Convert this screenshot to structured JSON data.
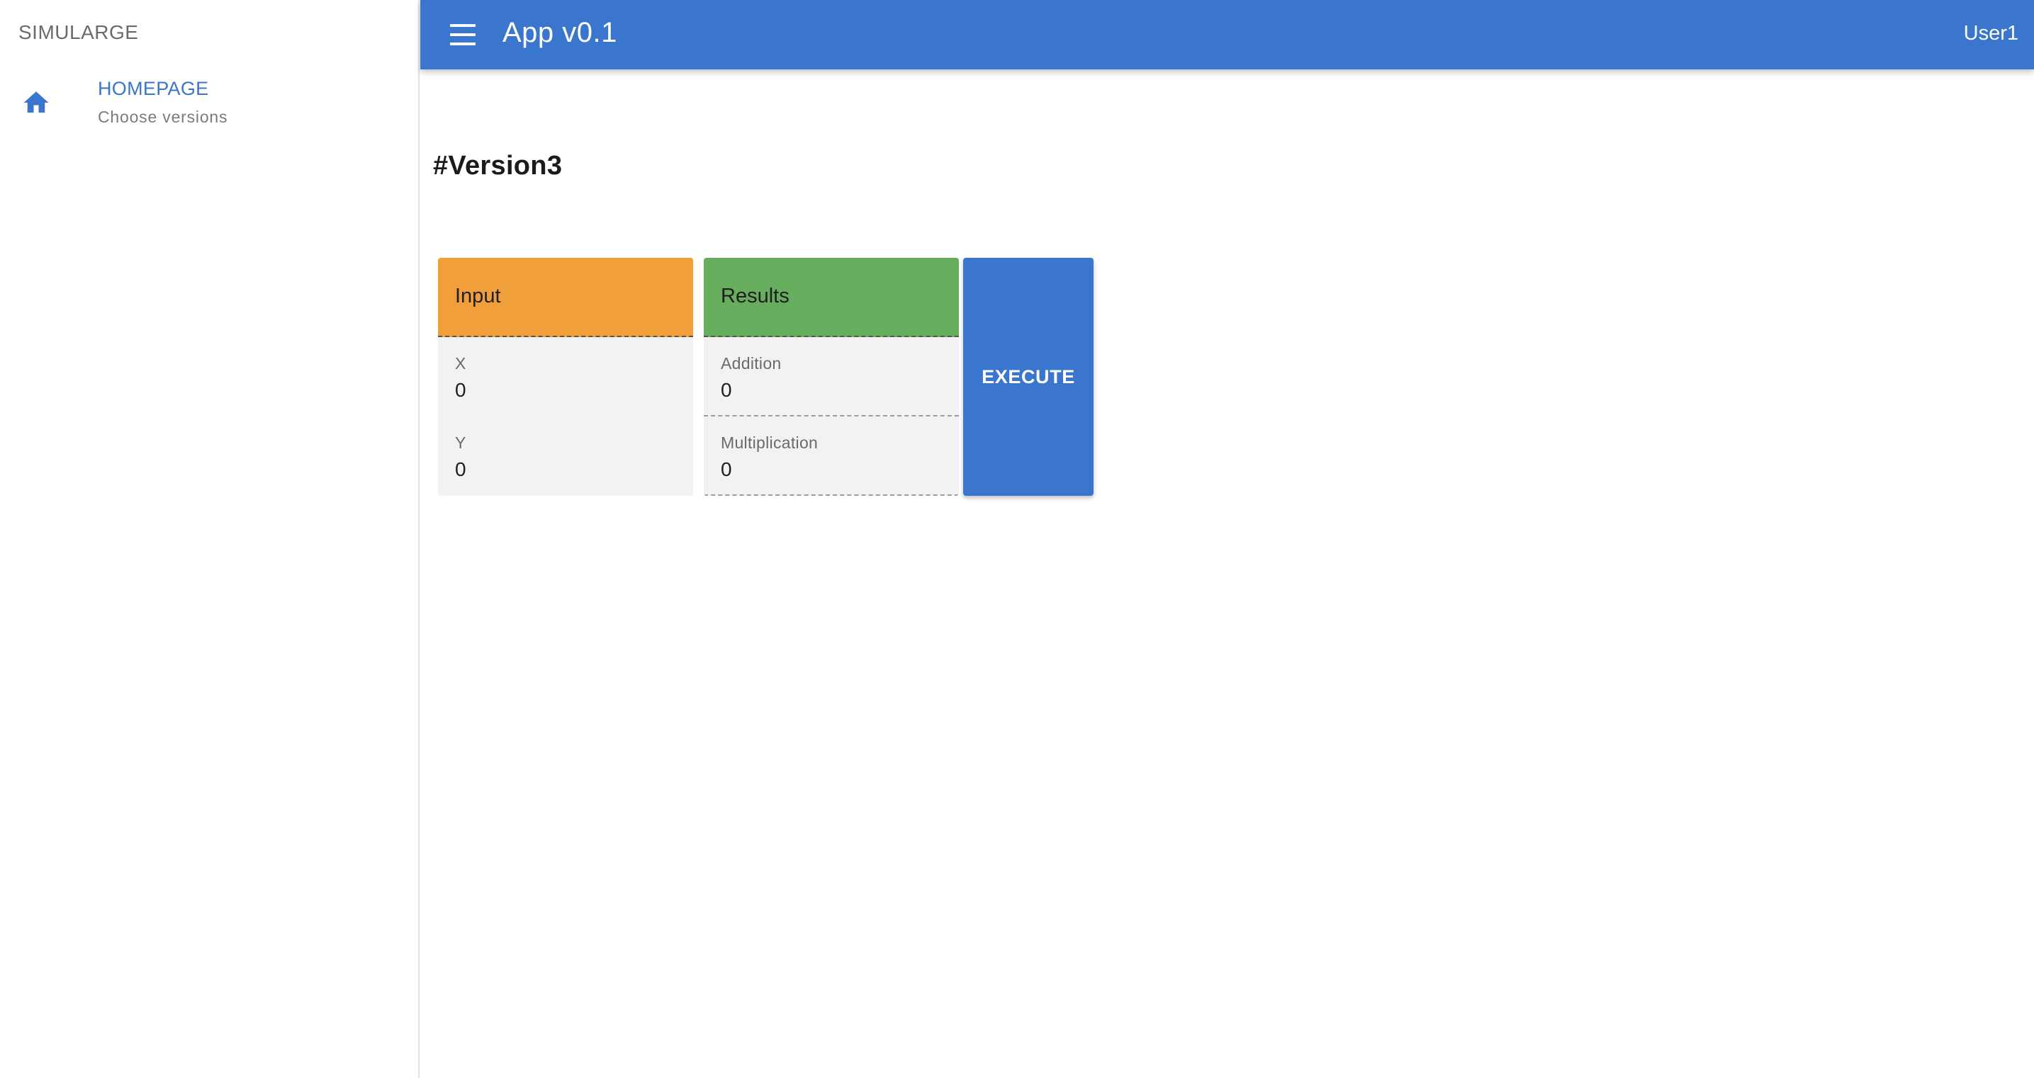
{
  "sidebar": {
    "brand": "SIMULARGE",
    "items": [
      {
        "icon": "home-icon",
        "label": "HOMEPAGE",
        "subtitle": "Choose versions"
      }
    ]
  },
  "appbar": {
    "menu_icon": "menu-icon",
    "title": "App v0.1",
    "user": "User1"
  },
  "main": {
    "page_title": "#Version3",
    "input_card": {
      "title": "Input",
      "fields": [
        {
          "label": "X",
          "value": "0"
        },
        {
          "label": "Y",
          "value": "0"
        }
      ]
    },
    "results_card": {
      "title": "Results",
      "fields": [
        {
          "label": "Addition",
          "value": "0"
        },
        {
          "label": "Multiplication",
          "value": "0"
        }
      ]
    },
    "execute_label": "EXECUTE"
  },
  "colors": {
    "primary": "#3a75ce",
    "input_header": "#f19f3b",
    "results_header": "#67ad5e",
    "card_background": "#f2f2f2"
  }
}
